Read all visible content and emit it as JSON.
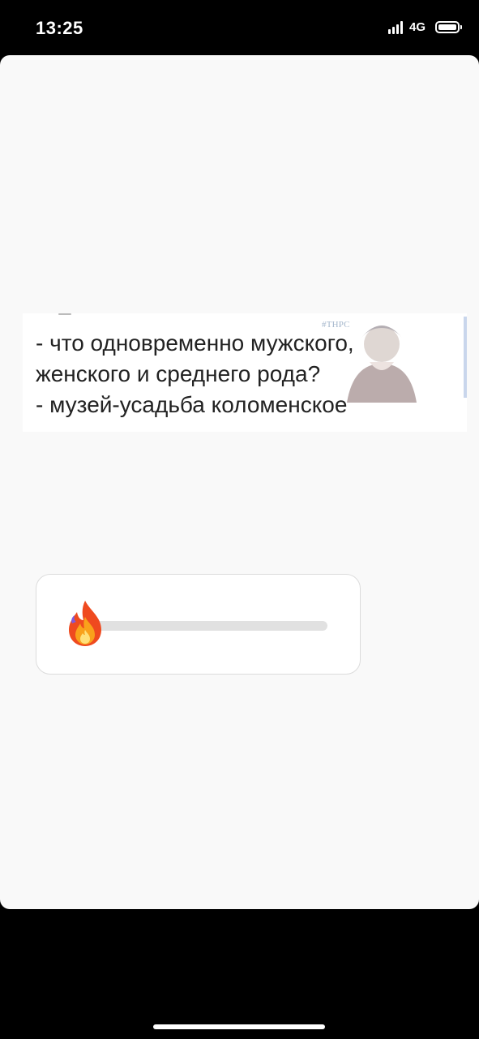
{
  "status_bar": {
    "time": "13:25",
    "network": "4G",
    "signal_icon": "signal-bars-icon",
    "battery_icon": "battery-icon"
  },
  "story": {
    "meme": {
      "watermark": "#THPC",
      "lines": [
        "- что одновременно мужского,",
        "женского и среднего рода?",
        "- музей-усадьба коломенское"
      ]
    },
    "slider": {
      "emoji": "🔥",
      "emoji_icon": "fire-emoji-icon",
      "value": 0
    }
  },
  "colors": {
    "background": "#000000",
    "card": "#f9f9f9",
    "track": "#e1e1e1"
  }
}
